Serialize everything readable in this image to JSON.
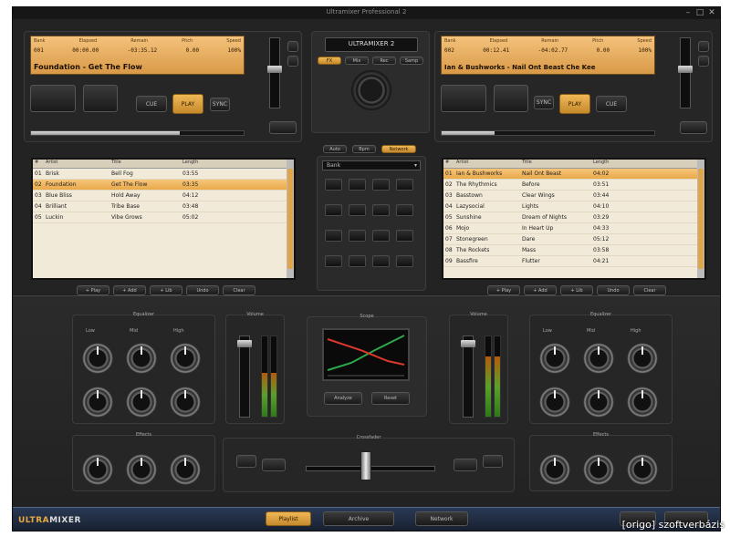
{
  "window": {
    "title": "Ultramixer Professional 2"
  },
  "brand": {
    "name_main": "ULTRA",
    "name_rest": "MIXER"
  },
  "watermark": "[origo] szoftverbázis",
  "deck_left": {
    "lcd_headers": [
      "Bank",
      "Elapsed",
      "Remain",
      "Pitch",
      "Speed"
    ],
    "lcd_values": [
      "001",
      "00:00.00",
      "-03:35.12",
      "0.00",
      "100%"
    ],
    "track": "Foundation - Get The Flow",
    "buttons": [
      "CUE",
      "PLAY",
      "SYNC"
    ],
    "progress": 0.7
  },
  "deck_right": {
    "lcd_headers": [
      "Bank",
      "Elapsed",
      "Remain",
      "Pitch",
      "Speed"
    ],
    "lcd_values": [
      "002",
      "00:12.41",
      "-04:02.77",
      "0.00",
      "100%"
    ],
    "track": "Ian & Bushworks - Nail Ont Beast Che Kee",
    "buttons": [
      "CUE",
      "PLAY",
      "SYNC"
    ],
    "progress": 0.25
  },
  "playlist_left": {
    "headers": [
      "#",
      "Artist",
      "Title",
      "Length"
    ],
    "rows": [
      [
        "01",
        "Brisk",
        "Bell Fog",
        "03:55"
      ],
      [
        "02",
        "Foundation",
        "Get The Flow",
        "03:35"
      ],
      [
        "03",
        "Blue Bliss",
        "Hold Away",
        "04:12"
      ],
      [
        "04",
        "Brilliant",
        "Tribe Base",
        "03:48"
      ],
      [
        "05",
        "Luckin",
        "Vibe Grows",
        "05:02"
      ]
    ],
    "selected": 1,
    "buttons": [
      "+ Play",
      "+ Add",
      "+ Lib",
      "Undo",
      "Clear"
    ]
  },
  "playlist_right": {
    "headers": [
      "#",
      "Artist",
      "Title",
      "Length"
    ],
    "rows": [
      [
        "01",
        "Ian & Bushworks",
        "Nail Ont Beast",
        "04:02"
      ],
      [
        "02",
        "The Rhythmics",
        "Before",
        "03:51"
      ],
      [
        "03",
        "Basstown",
        "Clear Wings",
        "03:44"
      ],
      [
        "04",
        "Lazysocial",
        "Lights",
        "04:10"
      ],
      [
        "05",
        "Sunshine",
        "Dream of Nights",
        "03:29"
      ],
      [
        "06",
        "Mojo",
        "In Heart Up",
        "04:33"
      ],
      [
        "07",
        "Stonegreen",
        "Dare",
        "05:12"
      ],
      [
        "08",
        "The Rockets",
        "Mass",
        "03:58"
      ],
      [
        "09",
        "Bassfire",
        "Flutter",
        "04:21"
      ]
    ],
    "selected": 0,
    "buttons": [
      "+ Play",
      "+ Add",
      "+ Lib",
      "Undo",
      "Clear"
    ]
  },
  "center": {
    "logo": "ULTRAMIXER 2",
    "tabs": [
      "FX",
      "Mix",
      "Rec",
      "Samp"
    ],
    "bottom_tabs": [
      "Auto",
      "Bpm",
      "Network"
    ],
    "dropdown": "Bank"
  },
  "mixer": {
    "eq_left_title": "Equalizer",
    "eq_right_title": "Equalizer",
    "fx_left_title": "Effects",
    "fx_right_title": "Effects",
    "vol_left_title": "Volume",
    "vol_right_title": "Volume",
    "screen_title": "Scope",
    "crossfader_title": "Crossfader",
    "knob_labels": [
      "Low",
      "Mid",
      "High"
    ],
    "screen_buttons": [
      "Analyze",
      "Reset"
    ],
    "vol_left_level": 0.55,
    "vol_right_level": 0.75
  },
  "status_bar": {
    "buttons": [
      "Playlist",
      "Archive",
      "Network"
    ]
  }
}
